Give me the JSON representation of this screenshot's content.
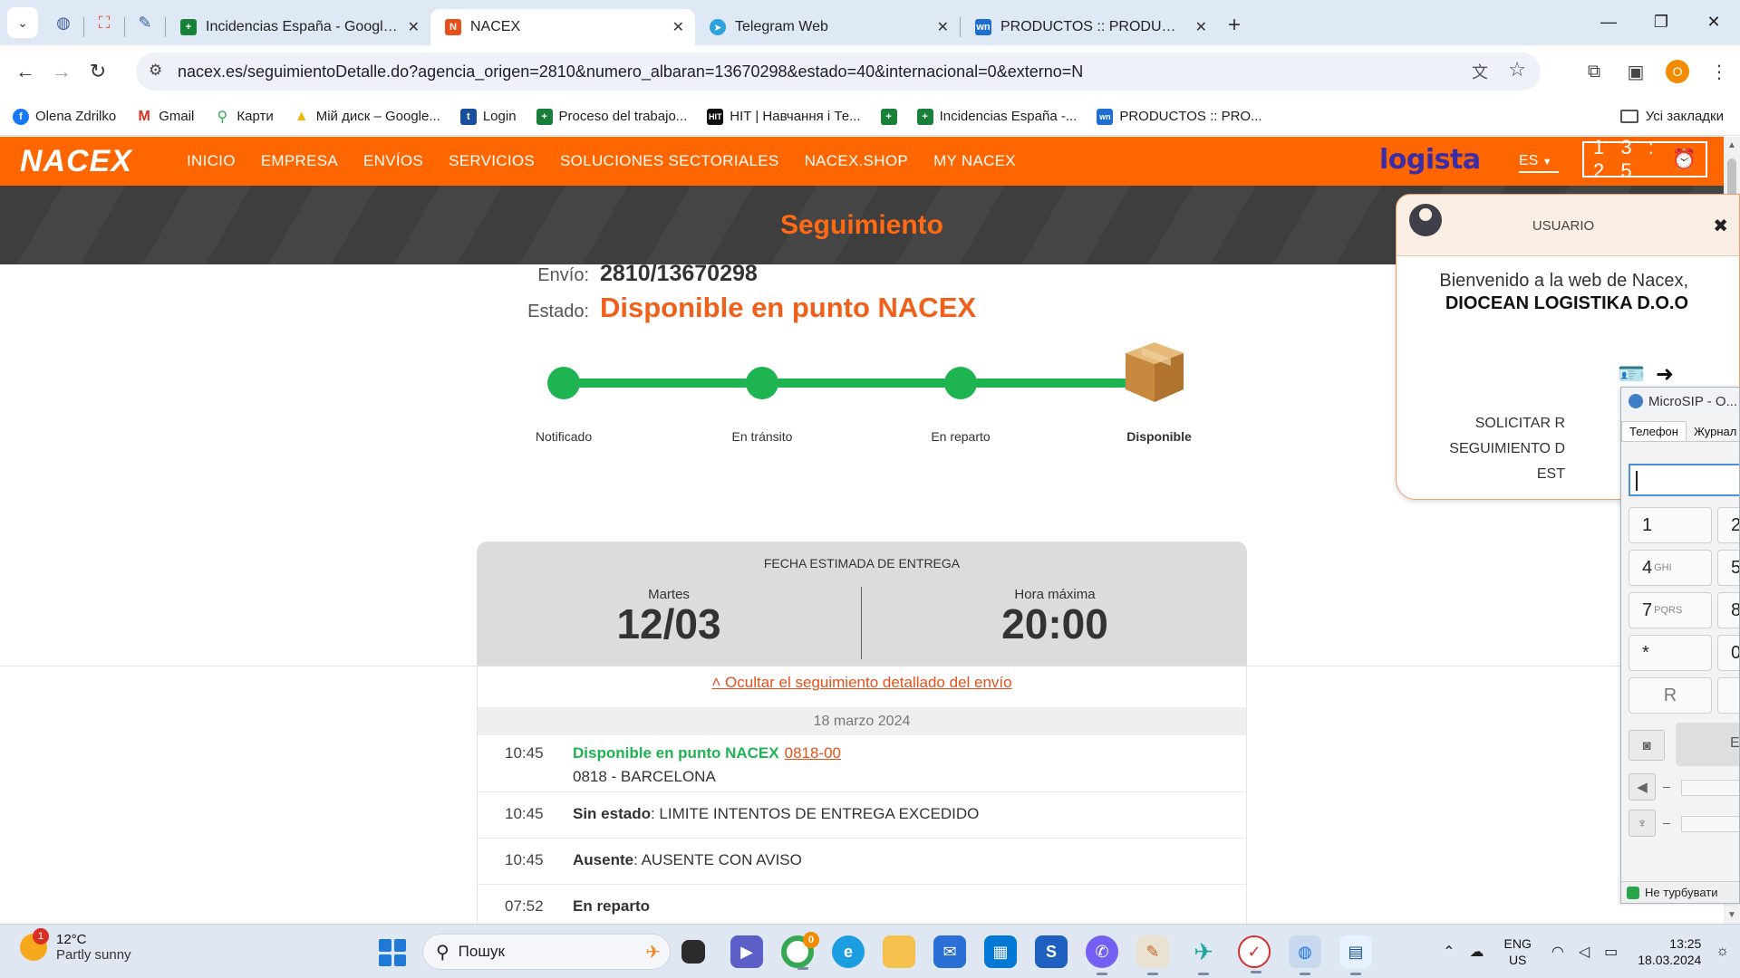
{
  "browser": {
    "tabs": [
      {
        "title": "Incidencias España - Google Ta",
        "favicon": "sheets-icon",
        "active": false
      },
      {
        "title": "NACEX",
        "favicon": "nacex-icon",
        "active": true
      },
      {
        "title": "Telegram Web",
        "favicon": "telegram-icon",
        "active": false
      },
      {
        "title": "PRODUCTOS :: PRODUCTOS NA",
        "favicon": "wn-icon",
        "active": false
      }
    ],
    "url": "nacex.es/seguimientoDetalle.do?agencia_origen=2810&numero_albaran=13670298&estado=40&internacional=0&externo=N",
    "profile_initial": "O",
    "bookmarks": [
      {
        "label": "Olena Zdrilko",
        "icon": "facebook-icon",
        "color": "#1877f2"
      },
      {
        "label": "Gmail",
        "icon": "gmail-icon",
        "color": "#d93025"
      },
      {
        "label": "Карти",
        "icon": "maps-icon",
        "color": "#34a853"
      },
      {
        "label": "Мій диск – Google...",
        "icon": "drive-icon",
        "color": "#f4b400"
      },
      {
        "label": "Login",
        "icon": "login-icon",
        "color": "#1a4f9c"
      },
      {
        "label": "Proceso del trabajo...",
        "icon": "sheets-icon",
        "color": "#188038"
      },
      {
        "label": "HIT | Навчання і Те...",
        "icon": "hit-icon",
        "color": "#111111"
      },
      {
        "label": "",
        "icon": "sheets-icon",
        "color": "#188038"
      },
      {
        "label": "Incidencias España -...",
        "icon": "sheets-icon",
        "color": "#188038"
      },
      {
        "label": "PRODUCTOS :: PRO...",
        "icon": "wn-icon",
        "color": "#1c6fd1"
      }
    ],
    "all_bookmarks": "Усі закладки"
  },
  "nacex": {
    "logo": "NACEX",
    "menu": [
      "INICIO",
      "EMPRESA",
      "ENVÍOS",
      "SERVICIOS",
      "SOLUCIONES SECTORIALES",
      "NACEX.SHOP",
      "MY NACEX"
    ],
    "partner_logo": "logista",
    "lang": "ES",
    "clock": "1 3 : 2 5",
    "hero_title": "Seguimiento",
    "shipment": {
      "label_envio": "Envío:",
      "number": "2810/13670298",
      "label_estado": "Estado:",
      "state": "Disponible en punto NACEX"
    },
    "steps": [
      "Notificado",
      "En tránsito",
      "En reparto",
      "Disponible"
    ],
    "delivery": {
      "header": "FECHA ESTIMADA DE ENTREGA",
      "day_label": "Martes",
      "date": "12/03",
      "hour_label": "Hora máxima",
      "hour": "20:00"
    },
    "toggle_link": "˄ Ocultar el seguimiento detallado del envío",
    "date_bar": "18 marzo 2024",
    "events": [
      {
        "time": "10:45",
        "title": "Disponible en punto NACEX",
        "code": "0818-00",
        "detail": "0818 - BARCELONA"
      },
      {
        "time": "10:45",
        "title": "Sin estado",
        "detail": ": LIMITE INTENTOS DE ENTREGA EXCEDIDO"
      },
      {
        "time": "10:45",
        "title": "Ausente",
        "detail": ": AUSENTE CON AVISO"
      },
      {
        "time": "07:52",
        "title": "En reparto",
        "detail": ""
      }
    ]
  },
  "user_panel": {
    "title": "USUARIO",
    "welcome": "Bienvenido a la web de Nacex,",
    "company": "DIOCEAN LOGISTIKA D.O.O",
    "links": [
      "SOLICITAR R",
      "SEGUIMIENTO D",
      "EST"
    ]
  },
  "microsip": {
    "title": "MicroSIP - O...",
    "tabs": [
      "Телефон",
      "Журнал"
    ],
    "keys": [
      {
        "d": "1",
        "l": ""
      },
      {
        "d": "4",
        "l": "GHI"
      },
      {
        "d": "7",
        "l": "PQRS"
      },
      {
        "d": "*",
        "l": ""
      },
      {
        "d": "R",
        "l": ""
      }
    ],
    "right_keys": [
      "2",
      "5",
      "8",
      "0"
    ],
    "status": "Не турбувати",
    "call_partial": "E"
  },
  "taskbar": {
    "badge": "1",
    "temp": "12°C",
    "weather": "Partly sunny",
    "search": "Пошук",
    "chrome_badge": "0",
    "lang1": "ENG",
    "lang2": "US",
    "time": "13:25",
    "date": "18.03.2024"
  }
}
